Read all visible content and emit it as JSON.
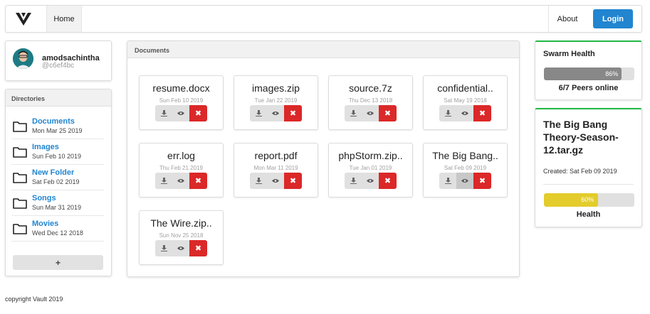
{
  "nav": {
    "home_label": "Home",
    "about_label": "About",
    "login_label": "Login",
    "logo_icon": "vault-logo-icon"
  },
  "profile": {
    "username": "amodsachintha",
    "hash": "@c6ef4bc"
  },
  "directories": {
    "header": "Directories",
    "items": [
      {
        "name": "Documents",
        "date": "Mon Mar 25 2019"
      },
      {
        "name": "Images",
        "date": "Sun Feb 10 2019"
      },
      {
        "name": "New Folder",
        "date": "Sat Feb 02 2019"
      },
      {
        "name": "Songs",
        "date": "Sun Mar 31 2019"
      },
      {
        "name": "Movies",
        "date": "Wed Dec 12 2018"
      }
    ],
    "add_label": "+"
  },
  "documents": {
    "header": "Documents",
    "files": [
      {
        "name": "resume.docx",
        "date": "Sun Feb 10 2019"
      },
      {
        "name": "images.zip",
        "date": "Tue Jan 22 2019"
      },
      {
        "name": "source.7z",
        "date": "Thu Dec 13 2018"
      },
      {
        "name": "confidential..",
        "date": "Sat May 19 2018"
      },
      {
        "name": "err.log",
        "date": "Thu Feb 21 2019"
      },
      {
        "name": "report.pdf",
        "date": "Mon Mar 11 2019"
      },
      {
        "name": "phpStorm.zip..",
        "date": "Tue Jan 01 2019"
      },
      {
        "name": "The Big Bang..",
        "date": "Sat Feb 09 2019"
      },
      {
        "name": "The Wire.zip..",
        "date": "Sun Nov 25 2018"
      }
    ],
    "delete_glyph": "✖"
  },
  "swarm": {
    "title": "Swarm Health",
    "percent_label": "86%",
    "percent": 86,
    "peers_text": "6/7 Peers online"
  },
  "selected_file": {
    "title": "The Big Bang Theory-Season-12.tar.gz",
    "created": "Created: Sat Feb 09 2019",
    "health_label_pct": "60%",
    "health": 60,
    "health_label": "Health"
  },
  "footer": {
    "text": "copyright Vault 2019"
  },
  "colors": {
    "primary": "#2185d0",
    "danger": "#db2828",
    "success_border": "#21ba45",
    "health_yellow": "#e3cc2b",
    "swarm_grey": "#888888"
  }
}
